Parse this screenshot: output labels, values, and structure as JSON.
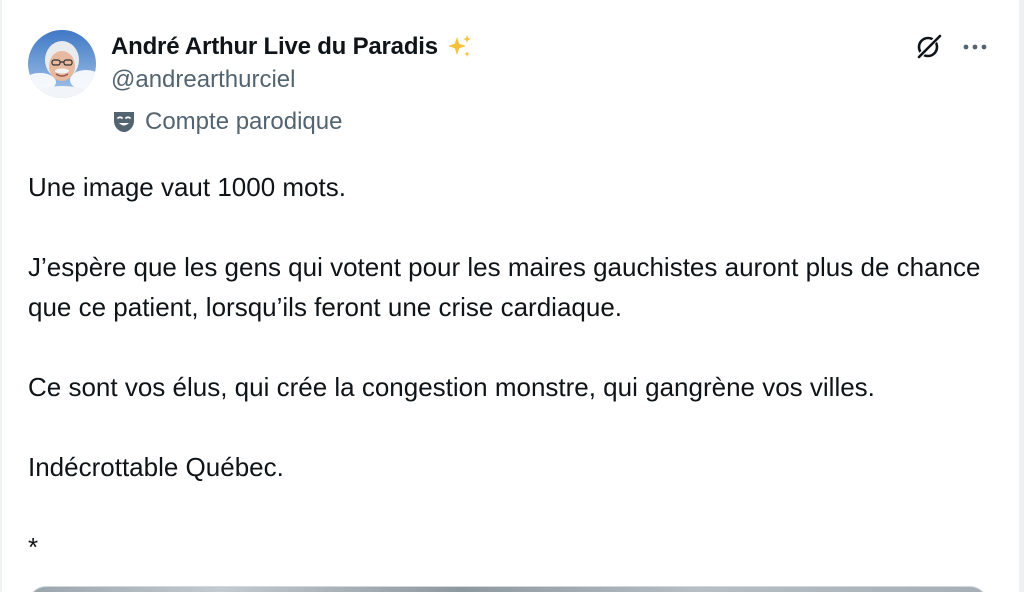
{
  "author": {
    "display_name": "André Arthur Live du Paradis",
    "handle": "@andrearthurciel",
    "badge": "sparkles-icon",
    "parody_label": "Compte parodique",
    "parody_icon": "theater-mask-icon"
  },
  "actions": {
    "grok_icon": "grok-icon",
    "more_icon": "more-icon"
  },
  "tweet": {
    "paragraphs": [
      "Une image vaut 1000 mots.",
      "J’espère que les gens qui votent pour les maires gauchistes auront plus de chance que ce patient, lorsqu’ils feront une crise cardiaque.",
      "Ce sont vos élus, qui crée la congestion monstre, qui gangrène vos villes.",
      "Indécrottable Québec.",
      "*"
    ]
  },
  "colors": {
    "text_primary": "#0f1419",
    "text_secondary": "#536471",
    "sparkle": "#f5c33b"
  }
}
